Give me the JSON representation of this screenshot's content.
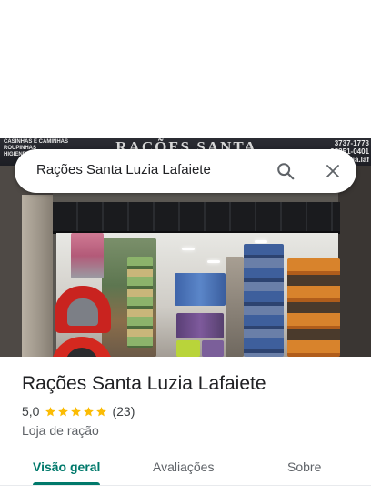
{
  "search": {
    "query": "Rações Santa Luzia Lafaiete"
  },
  "photo": {
    "sign_text": "RAÇÕES SANTA LUZIA",
    "sign_left_text": "CASINHAS E CAMINHAS\nROUPINHAS\nHIGIENE",
    "sign_right_text": "3737-1773\n98351-0401\nluzia.laf"
  },
  "place": {
    "name": "Rações Santa Luzia Lafaiete",
    "rating": "5,0",
    "stars": 5,
    "review_count": "(23)",
    "category": "Loja de ração"
  },
  "tabs": [
    {
      "label": "Visão geral",
      "active": true
    },
    {
      "label": "Avaliações",
      "active": false
    },
    {
      "label": "Sobre",
      "active": false
    }
  ],
  "colors": {
    "accent": "#00796b",
    "star": "#fbbc04"
  },
  "icons": {
    "search": "search-icon",
    "close": "close-icon",
    "star": "star-icon"
  }
}
